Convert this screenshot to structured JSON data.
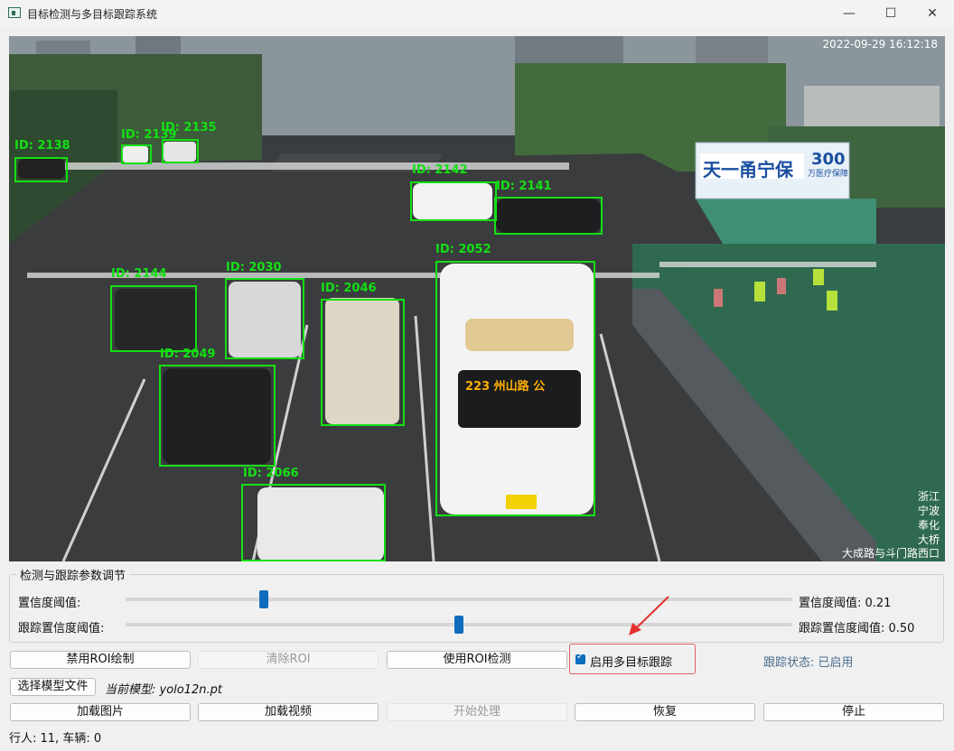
{
  "window": {
    "title": "目标检测与多目标跟踪系统",
    "minimize": "—",
    "maximize": "☐",
    "close": "✕"
  },
  "video": {
    "timestamp": "2022-09-29 16:12:18",
    "location_lines": [
      "浙江",
      "宁波",
      "奉化",
      "大桥",
      "大成路与斗门路西口"
    ],
    "bus_sign": "223 州山路 公",
    "billboard_title": "天一甬宁保",
    "billboard_num": "300",
    "billboard_sub": "万医疗保障",
    "detections": [
      {
        "id": "ID: 2138"
      },
      {
        "id": "ID: 2139"
      },
      {
        "id": "ID: 2135"
      },
      {
        "id": "ID: 2142"
      },
      {
        "id": "ID: 2141"
      },
      {
        "id": "ID: 2052"
      },
      {
        "id": "ID: 2144"
      },
      {
        "id": "ID: 2030"
      },
      {
        "id": "ID: 2046"
      },
      {
        "id": "ID: 2049"
      },
      {
        "id": "ID: 2066"
      }
    ]
  },
  "params": {
    "group_title": "检测与跟踪参数调节",
    "confidence_label": "置信度阈值:",
    "confidence_value_text": "置信度阈值: 0.21",
    "confidence_value": 0.21,
    "tracking_label": "跟踪置信度阈值:",
    "tracking_value_text": "跟踪置信度阈值: 0.50",
    "tracking_value": 0.5
  },
  "controls": {
    "disable_roi": "禁用ROI绘制",
    "clear_roi": "清除ROI",
    "use_roi": "使用ROI检测",
    "enable_tracking": "启用多目标跟踪",
    "tracking_status": "跟踪状态: 已启用",
    "select_model": "选择模型文件",
    "current_model": "当前模型: yolo12n.pt",
    "load_image": "加载图片",
    "load_video": "加载视频",
    "start": "开始处理",
    "resume": "恢复",
    "stop": "停止",
    "counts": "行人: 11, 车辆: 0"
  },
  "colors": {
    "accent": "#0f6cbd",
    "detection": "#14e014",
    "highlight": "#e06060"
  }
}
